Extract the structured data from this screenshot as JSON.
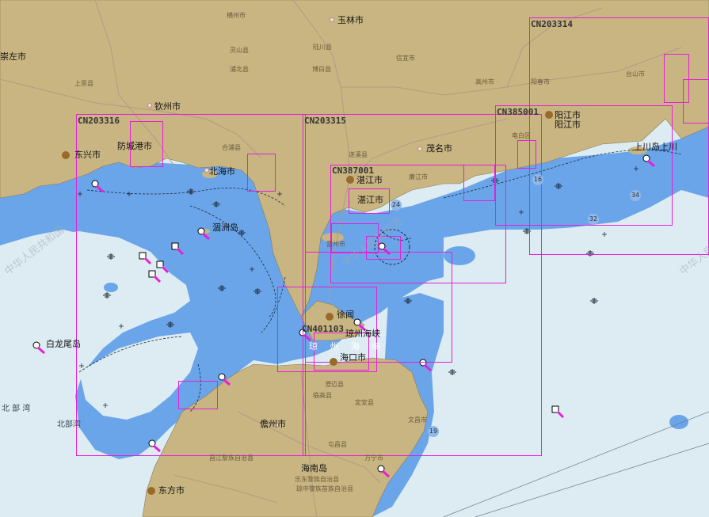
{
  "colors": {
    "land": "#c9b581",
    "shallow": "#6aa5ea",
    "deep": "#dcecf2",
    "frame": "#e61fd8",
    "road": "#b39a86"
  },
  "map": {
    "cities": {
      "yulin": "玉林市",
      "qinzhou": "钦州市",
      "fangchenggang": "防城港市",
      "beihai": "北海市",
      "zhanjiang": "湛江市",
      "maoming": "茂名市",
      "yangjiang": "阳江市",
      "haikou": "海口市",
      "xuwen": "徐闻",
      "danzhou": "儋州市",
      "dongfang": "东方市",
      "hainan_island": "海南岛",
      "chongzuo": "崇左市",
      "weizhou": "涸洲岛",
      "bailongwei": "白龙尾岛",
      "shangchuan": "上川岛上川",
      "zhanjiang_shi": "湛江市",
      "bamei": "东兴市"
    },
    "towns": [
      "横州市",
      "灵山县",
      "浦北县",
      "上思县",
      "博白县",
      "信宜市",
      "陆川县",
      "合浦县",
      "廉江市",
      "遂溪县",
      "雷州市",
      "阳春市",
      "高州市",
      "电白区",
      "台山市",
      "临高县",
      "澄迈县",
      "定安县",
      "文昌市",
      "屯昌县",
      "昌江黎族自治县",
      "乐东黎族自治县",
      "万宁市",
      "琼中黎族苗族自治县"
    ],
    "sea_labels": {
      "beibu_gulf": "北部湾",
      "beibu_gulf_spaced": "北 部 湾",
      "qiongzhou_strait": "琼州海峡",
      "strait_spaced": "琼 州 海 峡"
    },
    "watermarks": [
      "中华人民共和国",
      "中华人民共和国",
      "中华人民共和国"
    ],
    "charts": [
      {
        "id": "CN203316"
      },
      {
        "id": "CN203315"
      },
      {
        "id": "CN387001"
      },
      {
        "id": "CN385001"
      },
      {
        "id": "CN203314"
      },
      {
        "id": "CN401103"
      }
    ],
    "depths": [
      "24",
      "16",
      "32",
      "34",
      "19"
    ]
  }
}
